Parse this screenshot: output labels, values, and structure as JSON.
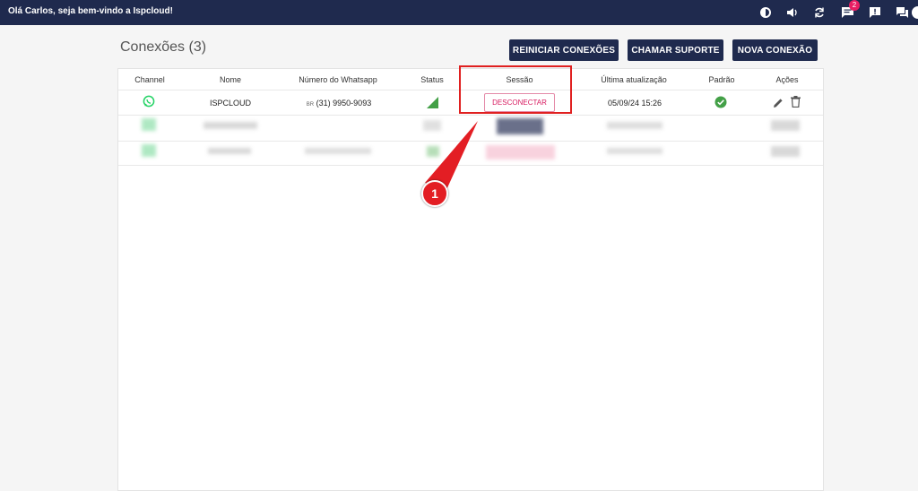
{
  "header": {
    "greeting": "Olá Carlos, seja bem-vindo a Ispcloud!",
    "notification_count": "2",
    "icons": [
      "brightness-icon",
      "volume-icon",
      "refresh-icon",
      "chat-icon",
      "alert-icon",
      "messages-icon",
      "avatar"
    ]
  },
  "page": {
    "title": "Conexões (3)",
    "buttons": {
      "restart": "REINICIAR CONEXÕES",
      "support": "CHAMAR SUPORTE",
      "new": "NOVA CONEXÃO"
    }
  },
  "table": {
    "columns": [
      "Channel",
      "Nome",
      "Número do Whatsapp",
      "Status",
      "Sessão",
      "Última atualização",
      "Padrão",
      "Ações"
    ],
    "rows": [
      {
        "channel_icon": "whatsapp-icon",
        "name": "ISPCLOUD",
        "flag": "BR",
        "phone": "(31) 9950-9093",
        "status_icon": "signal-icon",
        "session_button": "DESCONECTAR",
        "updated": "05/09/24 15:26",
        "default_icon": "check-circle-icon"
      }
    ]
  },
  "annotation": {
    "marker_label": "1"
  },
  "colors": {
    "navy": "#1f2a4e",
    "whatsapp": "#25d366",
    "pink": "#d81b60",
    "red": "#e02020",
    "check": "#43a047"
  }
}
